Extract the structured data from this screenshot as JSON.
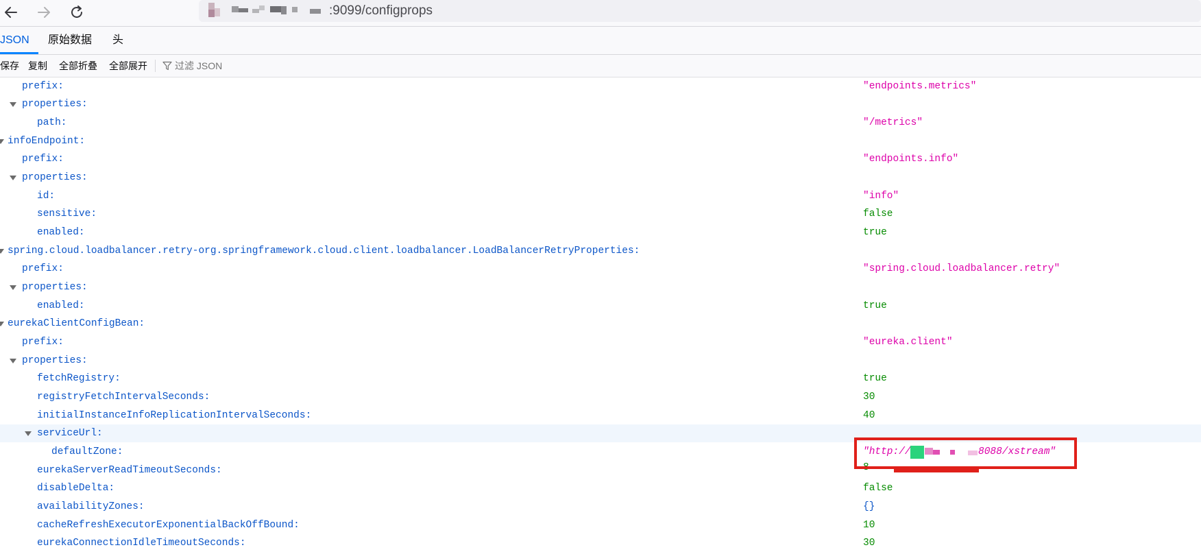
{
  "navbar": {
    "back_icon": "arrow-left-icon",
    "forward_icon": "arrow-right-icon",
    "reload_icon": "reload-icon",
    "url_visible": ":9099/configprops"
  },
  "tabs": [
    {
      "label": "JSON",
      "active": true
    },
    {
      "label": "原始数据",
      "active": false
    },
    {
      "label": "头",
      "active": false
    }
  ],
  "toolbar": {
    "save_label": "保存",
    "copy_label": "复制",
    "collapse_all_label": "全部折叠",
    "expand_all_label": "全部展开",
    "filter_placeholder": "过滤 JSON",
    "filter_icon": "funnel-icon"
  },
  "tree": {
    "rows": [
      {
        "key": "prefix:",
        "value": "\"endpoints.metrics\"",
        "type": "string"
      },
      {
        "key": "properties:",
        "value": "",
        "type": "object"
      },
      {
        "key": "path:",
        "value": "\"/metrics\"",
        "type": "string"
      },
      {
        "key": "infoEndpoint:",
        "value": "",
        "type": "object"
      },
      {
        "key": "prefix:",
        "value": "\"endpoints.info\"",
        "type": "string"
      },
      {
        "key": "properties:",
        "value": "",
        "type": "object"
      },
      {
        "key": "id:",
        "value": "\"info\"",
        "type": "string"
      },
      {
        "key": "sensitive:",
        "value": "false",
        "type": "boolean"
      },
      {
        "key": "enabled:",
        "value": "true",
        "type": "boolean"
      },
      {
        "key": "spring.cloud.loadbalancer.retry-org.springframework.cloud.client.loadbalancer.LoadBalancerRetryProperties:",
        "value": "",
        "type": "object"
      },
      {
        "key": "prefix:",
        "value": "\"spring.cloud.loadbalancer.retry\"",
        "type": "string"
      },
      {
        "key": "properties:",
        "value": "",
        "type": "object"
      },
      {
        "key": "enabled:",
        "value": "true",
        "type": "boolean"
      },
      {
        "key": "eurekaClientConfigBean:",
        "value": "",
        "type": "object"
      },
      {
        "key": "prefix:",
        "value": "\"eureka.client\"",
        "type": "string"
      },
      {
        "key": "properties:",
        "value": "",
        "type": "object"
      },
      {
        "key": "fetchRegistry:",
        "value": "true",
        "type": "boolean"
      },
      {
        "key": "registryFetchIntervalSeconds:",
        "value": "30",
        "type": "number"
      },
      {
        "key": "initialInstanceInfoReplicationIntervalSeconds:",
        "value": "40",
        "type": "number"
      },
      {
        "key": "serviceUrl:",
        "value": "",
        "type": "object"
      },
      {
        "key": "defaultZone:",
        "value_prefix": "\"http://",
        "value_suffix": "8088/xstream\"",
        "type": "string"
      },
      {
        "key": "eurekaServerReadTimeoutSeconds:",
        "value": "8",
        "type": "number"
      },
      {
        "key": "disableDelta:",
        "value": "false",
        "type": "boolean"
      },
      {
        "key": "availabilityZones:",
        "value": "{}",
        "type": "object-empty"
      },
      {
        "key": "cacheRefreshExecutorExponentialBackOffBound:",
        "value": "10",
        "type": "number"
      },
      {
        "key": "eurekaConnectionIdleTimeoutSeconds:",
        "value": "30",
        "type": "number"
      }
    ]
  },
  "colors": {
    "key": "#0b55c8",
    "string": "#dd00a9",
    "boolean_number": "#058b00",
    "highlight_box": "#e0201a",
    "active_tab": "#0a84ff"
  }
}
